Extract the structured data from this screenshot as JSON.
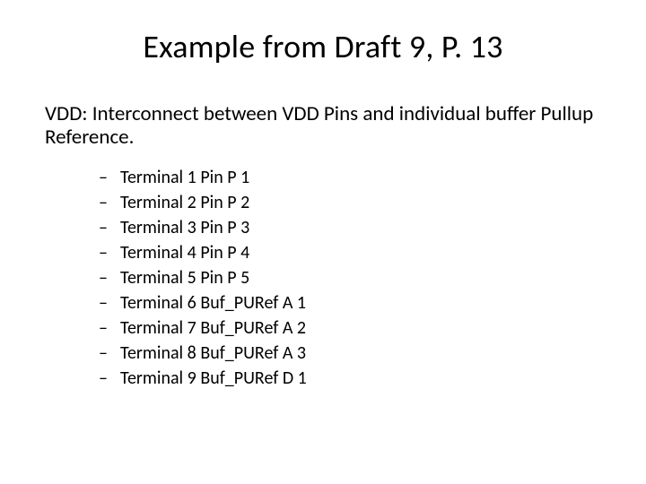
{
  "title": "Example from Draft 9, P. 13",
  "subtitle": "VDD: Interconnect between VDD Pins and individual buffer Pullup Reference.",
  "dash": "–",
  "items": [
    "Terminal 1 Pin P 1",
    "Terminal 2 Pin P 2",
    "Terminal 3 Pin P 3",
    "Terminal 4 Pin P 4",
    "Terminal 5 Pin P 5",
    "Terminal 6 Buf_PURef A 1",
    "Terminal 7 Buf_PURef A 2",
    "Terminal 8 Buf_PURef A 3",
    "Terminal 9 Buf_PURef D 1"
  ]
}
